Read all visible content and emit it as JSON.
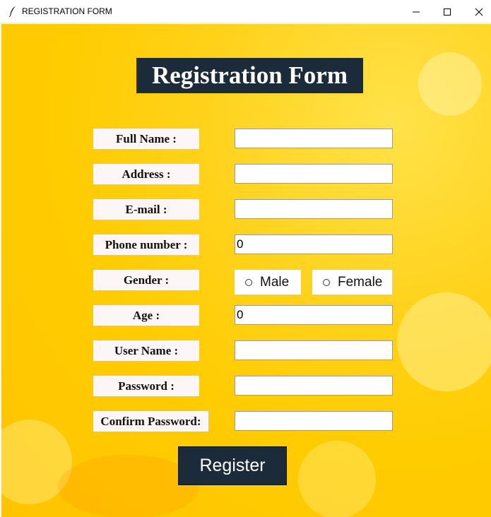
{
  "window": {
    "title": "REGISTRATION FORM",
    "controls": {
      "minimize_icon": "minimize-icon",
      "maximize_icon": "maximize-icon",
      "close_icon": "close-icon"
    }
  },
  "form": {
    "heading": "Registration Form",
    "labels": {
      "full_name": "Full Name :",
      "address": "Address :",
      "email": "E-mail :",
      "phone": "Phone number :",
      "gender": "Gender :",
      "age": "Age :",
      "username": "User Name :",
      "password": "Password :",
      "confirm_password": "Confirm Password:"
    },
    "values": {
      "full_name": "",
      "address": "",
      "email": "",
      "phone": "0",
      "age": "0",
      "username": "",
      "password": "",
      "confirm_password": ""
    },
    "gender_options": {
      "male": "Male",
      "female": "Female"
    },
    "register_label": "Register"
  },
  "colors": {
    "background": "#ffcc00",
    "title_bg": "#1c2b3a",
    "button_bg": "#1c2b3a",
    "label_bg": "#fdf6f6"
  }
}
